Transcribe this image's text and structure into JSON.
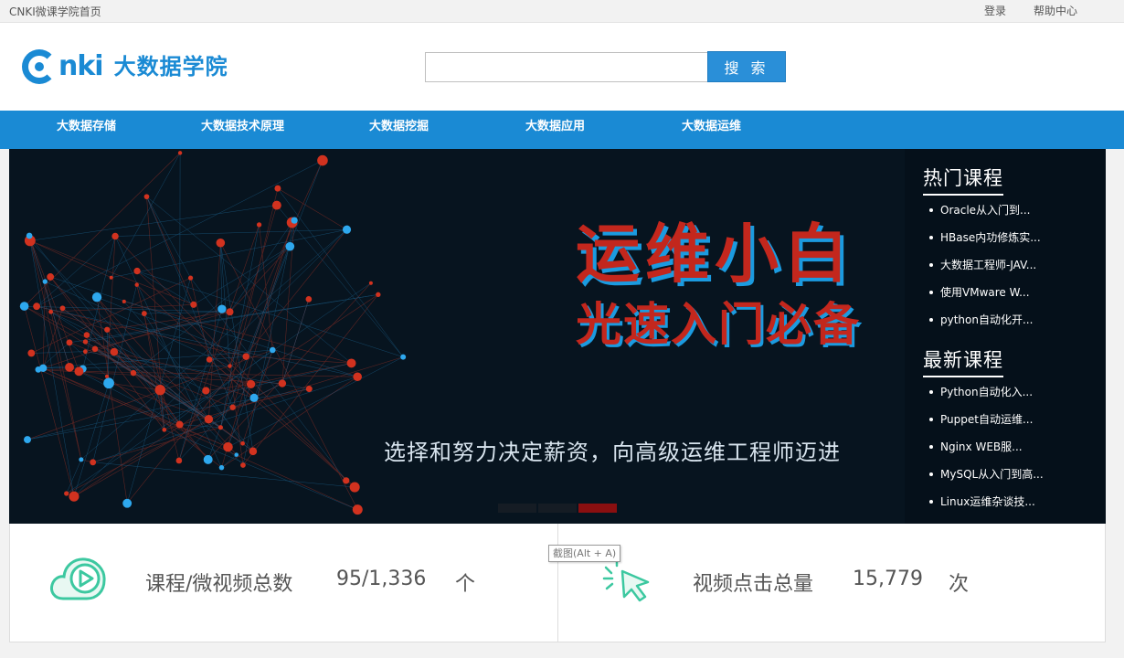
{
  "topbar": {
    "home_link": "CNKI微课学院首页",
    "login": "登录",
    "help": "帮助中心"
  },
  "header": {
    "logo_brand": "nki",
    "logo_text": "大数据学院",
    "search_placeholder": "",
    "search_button": "搜 索"
  },
  "nav": {
    "items": [
      "大数据存储",
      "大数据技术原理",
      "大数据挖掘",
      "大数据应用",
      "大数据运维"
    ]
  },
  "banner": {
    "headline_line1": "运维小白",
    "headline_line2": "光速入门必备",
    "slogan": "选择和努力决定薪资，向高级运维工程师迈进",
    "slide_count": 3,
    "active_slide": 3
  },
  "sidebar": {
    "hot_title": "热门课程",
    "hot_courses": [
      "Oracle从入门到...",
      "HBase内功修炼实...",
      "大数据工程师-JAV...",
      "使用VMware W...",
      "python自动化开..."
    ],
    "new_title": "最新课程",
    "new_courses": [
      "Python自动化入...",
      "Puppet自动运维...",
      "Nginx WEB服...",
      "MySQL从入门到高...",
      "Linux运维杂谈技..."
    ]
  },
  "stats": {
    "courses_label": "课程/微视频总数",
    "courses_value": "95/1,336",
    "courses_unit": "个",
    "views_label": "视频点击总量",
    "views_value": "15,779",
    "views_unit": "次"
  },
  "tooltip": {
    "text": "截图(Alt + A)"
  },
  "colors": {
    "brand": "#1a8ad4",
    "headline_red": "#c3271d",
    "headline_shadow": "#1b9be0",
    "stat_icon": "#3cc8a0"
  }
}
